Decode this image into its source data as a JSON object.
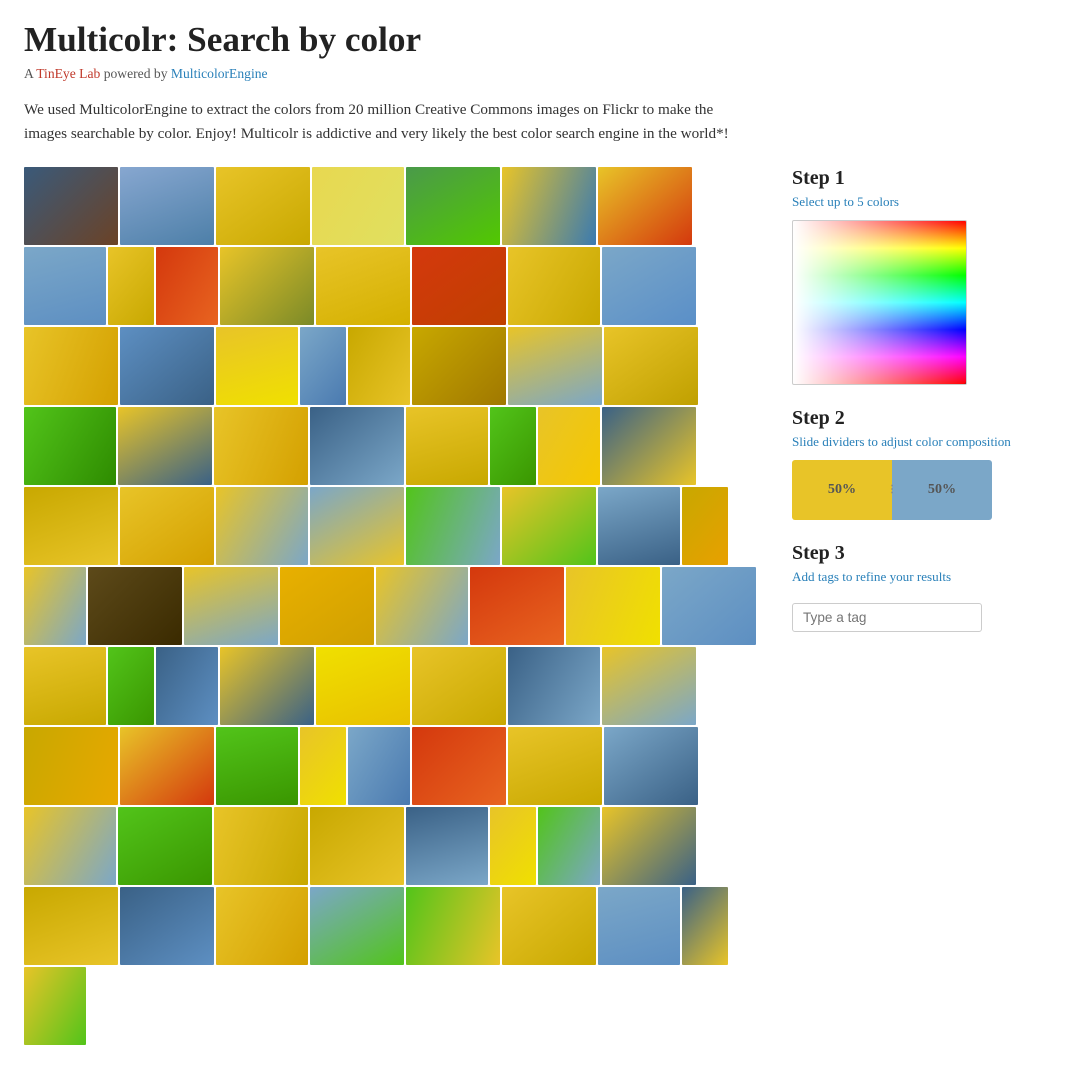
{
  "page": {
    "title": "Multicolr: Search by color",
    "subtitle_prefix": "A ",
    "subtitle_lab": "TinEye Lab",
    "subtitle_middle": " powered by ",
    "subtitle_engine": "MulticolorEngine",
    "description": "We used MulticolorEngine to extract the colors from 20 million Creative Commons images on Flickr to make the images searchable by color. Enjoy! Multicolr is addictive and very likely the best color search engine in the world*!"
  },
  "step1": {
    "title": "Step 1",
    "description": "Select up to 5 colors"
  },
  "step2": {
    "title": "Step 2",
    "description": "Slide dividers to adjust color composition",
    "color1_pct": "50%",
    "color2_pct": "50%",
    "color1_hex": "#e8c428",
    "color2_hex": "#7ba7c8"
  },
  "step3": {
    "title": "Step 3",
    "description": "Add tags to refine your results",
    "tag_placeholder": "Type a tag"
  },
  "mosaic": {
    "cells": [
      {
        "id": 1,
        "color": "#3a6186",
        "color2": "#6b4226"
      },
      {
        "id": 2,
        "color": "#87a7c0",
        "color2": "#5d9ecf"
      },
      {
        "id": 3,
        "color": "#e8c428",
        "color2": "#c8a800"
      },
      {
        "id": 4,
        "color": "#e8d850",
        "color2": "#f0e060"
      },
      {
        "id": 5,
        "color": "#4a7a9b",
        "color2": "#7ba7c8"
      },
      {
        "id": 6,
        "color": "#52c41a",
        "color2": "#3a9600"
      },
      {
        "id": 7,
        "color": "#52c41a",
        "color2": "#7ba7c8"
      },
      {
        "id": 8,
        "color": "#e8c428",
        "color2": "#f5e000"
      },
      {
        "id": 9,
        "color": "#d4380d",
        "color2": "#c04000"
      },
      {
        "id": 10,
        "color": "#e8c428",
        "color2": "#5d8fc2"
      },
      {
        "id": 11,
        "color": "#c8a800",
        "color2": "#e8c428"
      },
      {
        "id": 12,
        "color": "#5d8fc2",
        "color2": "#3a6186"
      },
      {
        "id": 13,
        "color": "#e8c428",
        "color2": "#c8a800"
      },
      {
        "id": 14,
        "color": "#7ba7c8",
        "color2": "#5a8fc8"
      },
      {
        "id": 15,
        "color": "#e8c428",
        "color2": "#d4a000"
      },
      {
        "id": 16,
        "color": "#52c41a",
        "color2": "#2e8b00"
      },
      {
        "id": 17,
        "color": "#e8c428",
        "color2": "#f0e000"
      },
      {
        "id": 18,
        "color": "#e8c428",
        "color2": "#7ba7c8"
      },
      {
        "id": 19,
        "color": "#3a6186",
        "color2": "#7ba7c8"
      },
      {
        "id": 20,
        "color": "#c8a800",
        "color2": "#e8c428"
      }
    ]
  }
}
